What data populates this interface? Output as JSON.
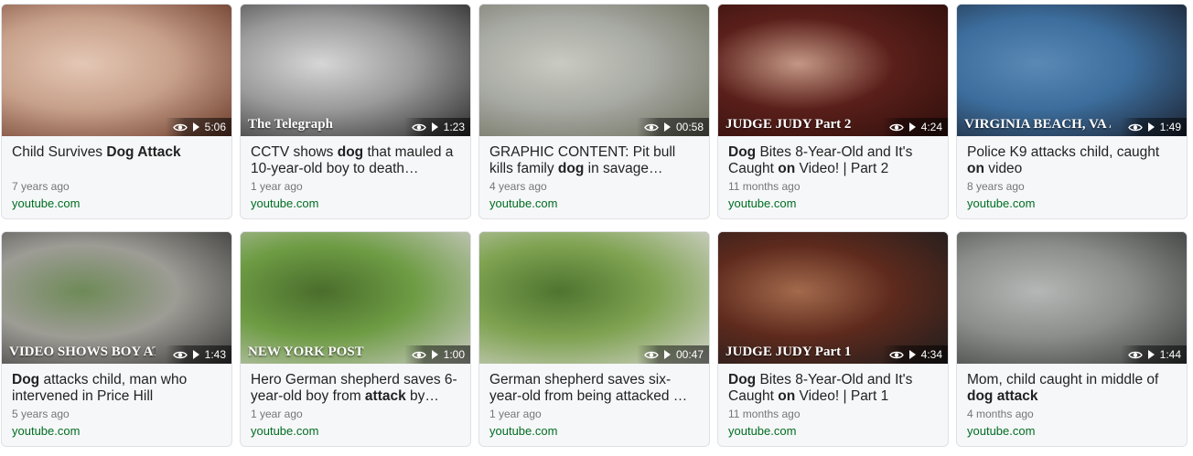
{
  "results": [
    {
      "title_parts": [
        {
          "t": "Child Survives ",
          "b": false
        },
        {
          "t": "Dog Attack",
          "b": true
        }
      ],
      "age": "7 years ago",
      "source": "youtube.com",
      "duration": "5:06",
      "thumb_colors": [
        "#c7a08a",
        "#6b3b2a",
        "#e4c7b5"
      ]
    },
    {
      "title_parts": [
        {
          "t": "CCTV shows ",
          "b": false
        },
        {
          "t": "dog",
          "b": true
        },
        {
          "t": " that mauled a 10-year-old boy to death…",
          "b": false
        }
      ],
      "age": "1 year ago",
      "source": "youtube.com",
      "duration": "1:23",
      "watermark": "The Telegraph",
      "thumb_colors": [
        "#9a9a9a",
        "#2b2b2b",
        "#d6d6d6"
      ]
    },
    {
      "title_parts": [
        {
          "t": "GRAPHIC CONTENT: Pit bull kills family ",
          "b": false
        },
        {
          "t": "dog",
          "b": true
        },
        {
          "t": " in savage…",
          "b": false
        }
      ],
      "age": "4 years ago",
      "source": "youtube.com",
      "duration": "00:58",
      "thumb_colors": [
        "#a7a9a3",
        "#6d6f5d",
        "#c9cbc1"
      ]
    },
    {
      "title_parts": [
        {
          "t": "Dog",
          "b": true
        },
        {
          "t": " Bites 8-Year-Old and It's Caught ",
          "b": false
        },
        {
          "t": "on",
          "b": true
        },
        {
          "t": " Video! | Part 2",
          "b": false
        }
      ],
      "age": "11 months ago",
      "source": "youtube.com",
      "duration": "4:24",
      "watermark": "JUDGE JUDY  Part 2",
      "thumb_colors": [
        "#5a1f1a",
        "#2e0f0c",
        "#c49785"
      ]
    },
    {
      "title_parts": [
        {
          "t": "Police K9 attacks child, caught ",
          "b": false
        },
        {
          "t": "on",
          "b": true
        },
        {
          "t": " video",
          "b": false
        }
      ],
      "age": "8 years ago",
      "source": "youtube.com",
      "duration": "1:49",
      "watermark": "VIRGINIA BEACH, VA / WVEC",
      "thumb_colors": [
        "#3c6d9c",
        "#1c2230",
        "#5a89b5"
      ]
    },
    {
      "title_parts": [
        {
          "t": "Dog",
          "b": true
        },
        {
          "t": " attacks child, man who intervened in Price Hill",
          "b": false
        }
      ],
      "age": "5 years ago",
      "source": "youtube.com",
      "duration": "1:43",
      "watermark": "VIDEO SHOWS BOY ATTACKED BY DOG",
      "thumb_colors": [
        "#9d9c95",
        "#3a3a3a",
        "#6e8a57"
      ]
    },
    {
      "title_parts": [
        {
          "t": "Hero German shepherd saves 6-year-old boy from ",
          "b": false
        },
        {
          "t": "attack",
          "b": true
        },
        {
          "t": " by…",
          "b": false
        }
      ],
      "age": "1 year ago",
      "source": "youtube.com",
      "duration": "1:00",
      "watermark": "NEW YORK POST",
      "thumb_colors": [
        "#6e9c44",
        "#c9c9c2",
        "#4a6d2c"
      ]
    },
    {
      "title_parts": [
        {
          "t": "German shepherd saves six-year-old from being attacked …",
          "b": false
        }
      ],
      "age": "1 year ago",
      "source": "youtube.com",
      "duration": "00:47",
      "thumb_colors": [
        "#7ea250",
        "#d3d3cd",
        "#4e7430"
      ]
    },
    {
      "title_parts": [
        {
          "t": "Dog",
          "b": true
        },
        {
          "t": " Bites 8-Year-Old and It's Caught ",
          "b": false
        },
        {
          "t": "on",
          "b": true
        },
        {
          "t": " Video! | Part 1",
          "b": false
        }
      ],
      "age": "11 months ago",
      "source": "youtube.com",
      "duration": "4:34",
      "watermark": "JUDGE JUDY  Part 1",
      "thumb_colors": [
        "#5e2a1d",
        "#1d1d1d",
        "#a36a4c"
      ]
    },
    {
      "title_parts": [
        {
          "t": "Mom, child caught in middle of ",
          "b": false
        },
        {
          "t": "dog attack",
          "b": true
        }
      ],
      "age": "4 months ago",
      "source": "youtube.com",
      "duration": "1:44",
      "thumb_colors": [
        "#8c8e8c",
        "#3b3d3c",
        "#b4b7b5"
      ]
    }
  ]
}
